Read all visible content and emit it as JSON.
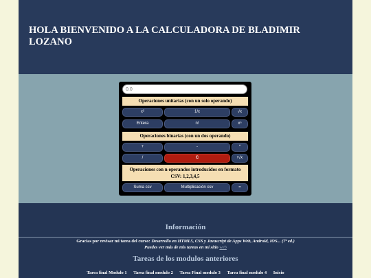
{
  "header": {
    "title": "HOLA BIENVENIDO A LA CALCULADORA DE BLADIMIR LOZANO"
  },
  "calculator": {
    "display": {
      "placeholder": "0.0"
    },
    "unary": {
      "heading": "Operaciones unitarias (con un solo operando)",
      "buttons": [
        "x²",
        "1/x",
        "√x",
        "Entera",
        "n!",
        "xⁿ"
      ]
    },
    "binary": {
      "heading": "Operaciones binarias (con un dos operando)",
      "buttons": [
        "+",
        "-",
        "*",
        "/",
        "C",
        "ʸ√x"
      ]
    },
    "csv": {
      "heading": "Operaciones con n operandos introducidos en formato CSV: 1,2,3,4,5",
      "buttons": [
        "Suma csv",
        "Multiplicación csv",
        "="
      ]
    }
  },
  "footer": {
    "info_title": "Información",
    "thanks_prefix": "Gracias por revisar mi tarea del curso:",
    "course_name": "Desarrollo en HTML5, CSS y Javascript de Apps Web, Android, IOS... (7ª ed.)",
    "site_text": "Puedes ver más de mis tareas en mi sitio",
    "site_link": "web",
    "prev_title": "Tareas de los modulos anteriores",
    "links": [
      "Tarea final Modulo 1",
      "Tarea final modulo 2",
      "Tarea Final modulo 3",
      "Tarea final modulo 4",
      "Inicio"
    ]
  },
  "colors": {
    "page_bg": "#f5f5dc",
    "header_bg": "#283a5b",
    "mid_bg": "#87a4ae",
    "section_bg": "#f5deb3",
    "button_bg": "#2d3e63",
    "clear_button_bg": "#b01c10"
  }
}
